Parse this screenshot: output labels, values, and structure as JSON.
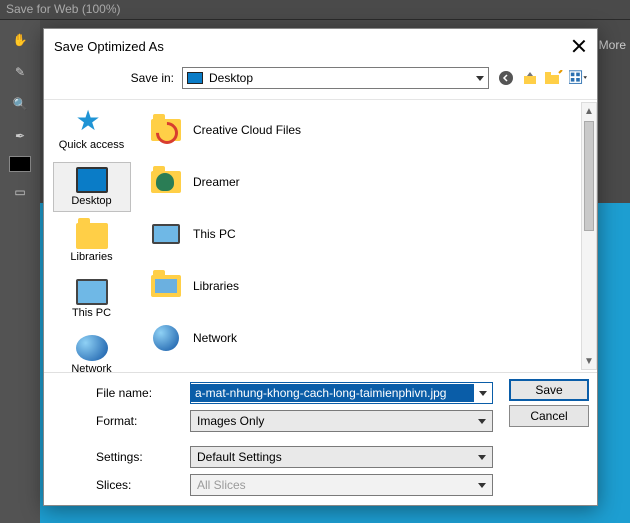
{
  "app": {
    "title": "Save for Web (100%)",
    "learn_more": "More"
  },
  "colors": {
    "swatch_fg": "#000000",
    "canvas": "#1d9ed1"
  },
  "dialog": {
    "title": "Save Optimized As"
  },
  "save_in": {
    "label": "Save in:",
    "value": "Desktop"
  },
  "nav_icons": {
    "back": "back-icon",
    "up": "up-icon",
    "newfolder": "new-folder-icon",
    "view": "view-menu-icon"
  },
  "places": [
    {
      "id": "quick",
      "label": "Quick access"
    },
    {
      "id": "desktop",
      "label": "Desktop"
    },
    {
      "id": "libraries",
      "label": "Libraries"
    },
    {
      "id": "thispc",
      "label": "This PC"
    },
    {
      "id": "network",
      "label": "Network"
    }
  ],
  "places_selected": "desktop",
  "files": [
    {
      "icon": "cc",
      "label": "Creative Cloud Files"
    },
    {
      "icon": "user",
      "label": "Dreamer"
    },
    {
      "icon": "pc",
      "label": "This PC"
    },
    {
      "icon": "lib",
      "label": "Libraries"
    },
    {
      "icon": "network",
      "label": "Network"
    }
  ],
  "form": {
    "filename_label": "File name:",
    "filename_value": "a-mat-nhung-khong-cach-long-taimienphivn.jpg",
    "format_label": "Format:",
    "format_value": "Images Only",
    "settings_label": "Settings:",
    "settings_value": "Default Settings",
    "slices_label": "Slices:",
    "slices_value": "All Slices",
    "save": "Save",
    "cancel": "Cancel"
  }
}
